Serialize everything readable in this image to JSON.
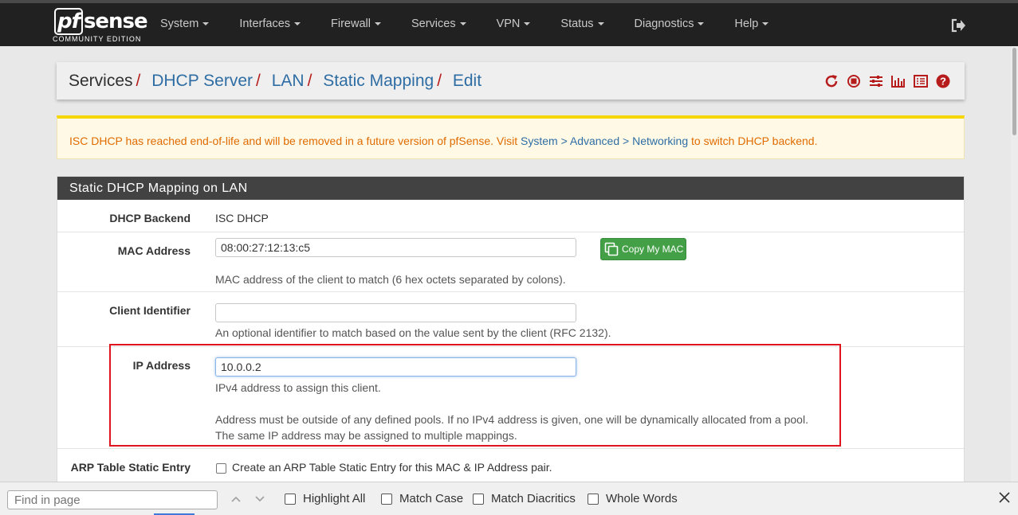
{
  "brand": {
    "name_pf": "pf",
    "name_rest": "sense",
    "edition": "COMMUNITY EDITION"
  },
  "nav": [
    "System",
    "Interfaces",
    "Firewall",
    "Services",
    "VPN",
    "Status",
    "Diagnostics",
    "Help"
  ],
  "breadcrumb": {
    "root": "Services",
    "items": [
      "DHCP Server",
      "LAN",
      "Static Mapping",
      "Edit"
    ]
  },
  "notice": {
    "prefix": "ISC DHCP has reached end-of-life and will be removed in a future version of pfSense. Visit ",
    "link": "System > Advanced > Networking",
    "suffix": " to switch DHCP backend."
  },
  "panel": {
    "title": "Static DHCP Mapping on LAN",
    "dhcp_backend": {
      "label": "DHCP Backend",
      "value": "ISC DHCP"
    },
    "mac": {
      "label": "MAC Address",
      "value": "08:00:27:12:13:c5",
      "button": "Copy My MAC",
      "help": "MAC address of the client to match (6 hex octets separated by colons)."
    },
    "client_id": {
      "label": "Client Identifier",
      "value": "",
      "help": "An optional identifier to match based on the value sent by the client (RFC 2132)."
    },
    "ip": {
      "label": "IP Address",
      "value": "10.0.0.2",
      "help1": "IPv4 address to assign this client.",
      "help2": "Address must be outside of any defined pools. If no IPv4 address is given, one will be dynamically allocated from a pool.",
      "help3": "The same IP address may be assigned to multiple mappings."
    },
    "arp": {
      "label": "ARP Table Static Entry",
      "text": "Create an ARP Table Static Entry for this MAC & IP Address pair.",
      "checked": false
    }
  },
  "findbar": {
    "placeholder": "Find in page",
    "options": [
      "Highlight All",
      "Match Case",
      "Match Diacritics",
      "Whole Words"
    ]
  },
  "colors": {
    "nav_bg": "#212121",
    "link": "#2e6da4",
    "separator": "#b71c1c",
    "warning_text": "#e06b00",
    "success": "#43a047",
    "highlight_box": "#e0141e"
  }
}
